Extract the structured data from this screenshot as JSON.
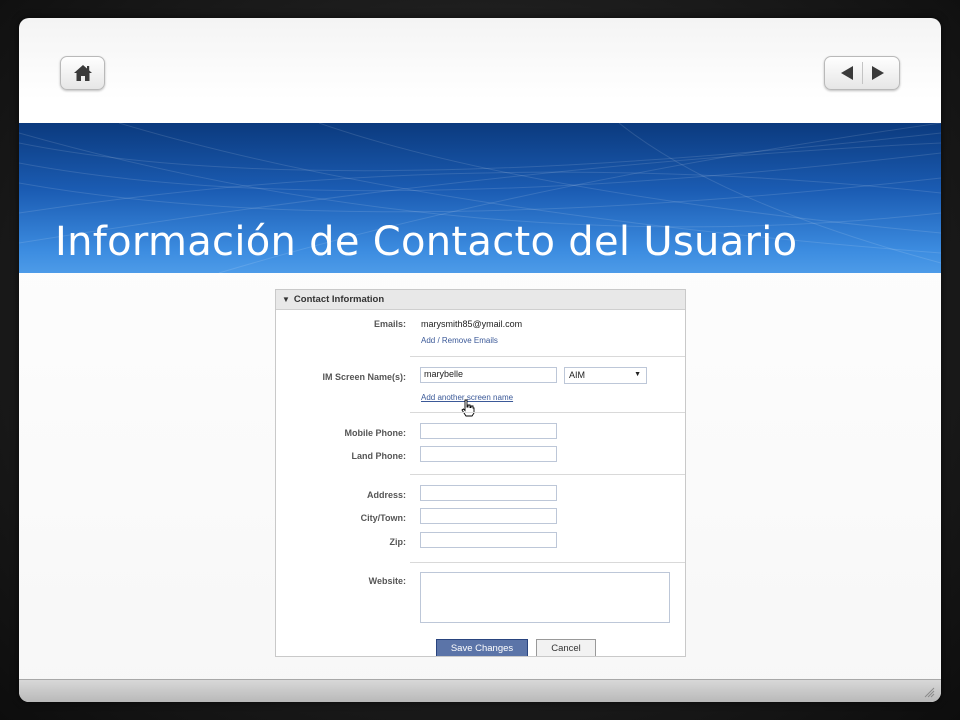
{
  "slide": {
    "title": "Información de Contacto del Usuario",
    "nav": {
      "home": "home-icon",
      "prev": "triangle-left-icon",
      "next": "triangle-right-icon"
    }
  },
  "form": {
    "header": "Contact Information",
    "emails_label": "Emails:",
    "email_value": "marysmith85@ymail.com",
    "emails_link": "Add / Remove Emails",
    "im_label": "IM Screen Name(s):",
    "im_value": "marybelle",
    "im_service": "AIM",
    "im_link": "Add another screen name",
    "mobile_label": "Mobile Phone:",
    "land_label": "Land Phone:",
    "address_label": "Address:",
    "city_label": "City/Town:",
    "zip_label": "Zip:",
    "website_label": "Website:",
    "save_label": "Save Changes",
    "cancel_label": "Cancel"
  },
  "colors": {
    "banner": "#1b5cb3",
    "link": "#3b5998",
    "save_button": "#5b74a8"
  }
}
